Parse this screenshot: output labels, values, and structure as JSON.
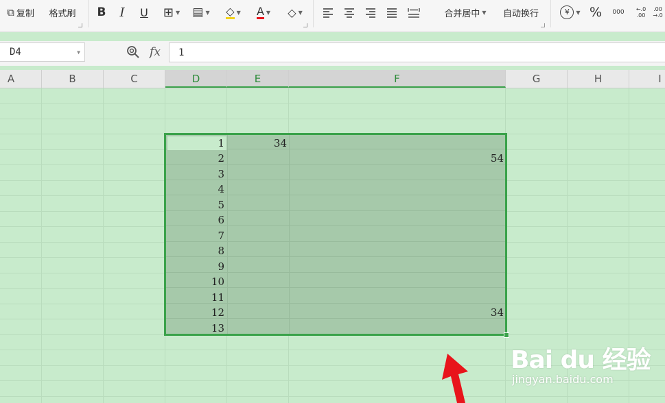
{
  "toolbar": {
    "copy_label": "复制",
    "format_painter_label": "格式刷",
    "bold_label": "B",
    "italic_label": "I",
    "underline_label": "U",
    "font_color_label": "A",
    "merge_center_label": "合并居中",
    "wrap_text_label": "自动换行",
    "currency_label": "¥",
    "percent_label": "%",
    "thousands_label": "000",
    "increase_decimal_label": "←.0 .00",
    "decrease_decimal_label": ".00 →.0"
  },
  "formula_bar": {
    "cell_reference": "D4",
    "fx_label": "fx",
    "formula_value": "1"
  },
  "columns": [
    "A",
    "B",
    "C",
    "D",
    "E",
    "F",
    "G",
    "H",
    "I"
  ],
  "selected_columns": [
    "D",
    "E",
    "F"
  ],
  "column_d_values": [
    "1",
    "2",
    "3",
    "4",
    "5",
    "6",
    "7",
    "8",
    "9",
    "10",
    "11",
    "12",
    "13"
  ],
  "column_e_values": [
    "34",
    "",
    "",
    "",
    "",
    "",
    "",
    "",
    "",
    "",
    "",
    "",
    ""
  ],
  "column_f_values": [
    "",
    "54",
    "",
    "",
    "",
    "",
    "",
    "",
    "",
    "",
    "",
    "34",
    ""
  ],
  "watermark": {
    "brand": "Bai du 经验",
    "url": "jingyan.baidu.com"
  },
  "colors": {
    "sheet_background": "#c8ebcc",
    "selection_fill": "#a6c9aa",
    "selection_border": "#3aa24a",
    "arrow": "#e8141b"
  }
}
